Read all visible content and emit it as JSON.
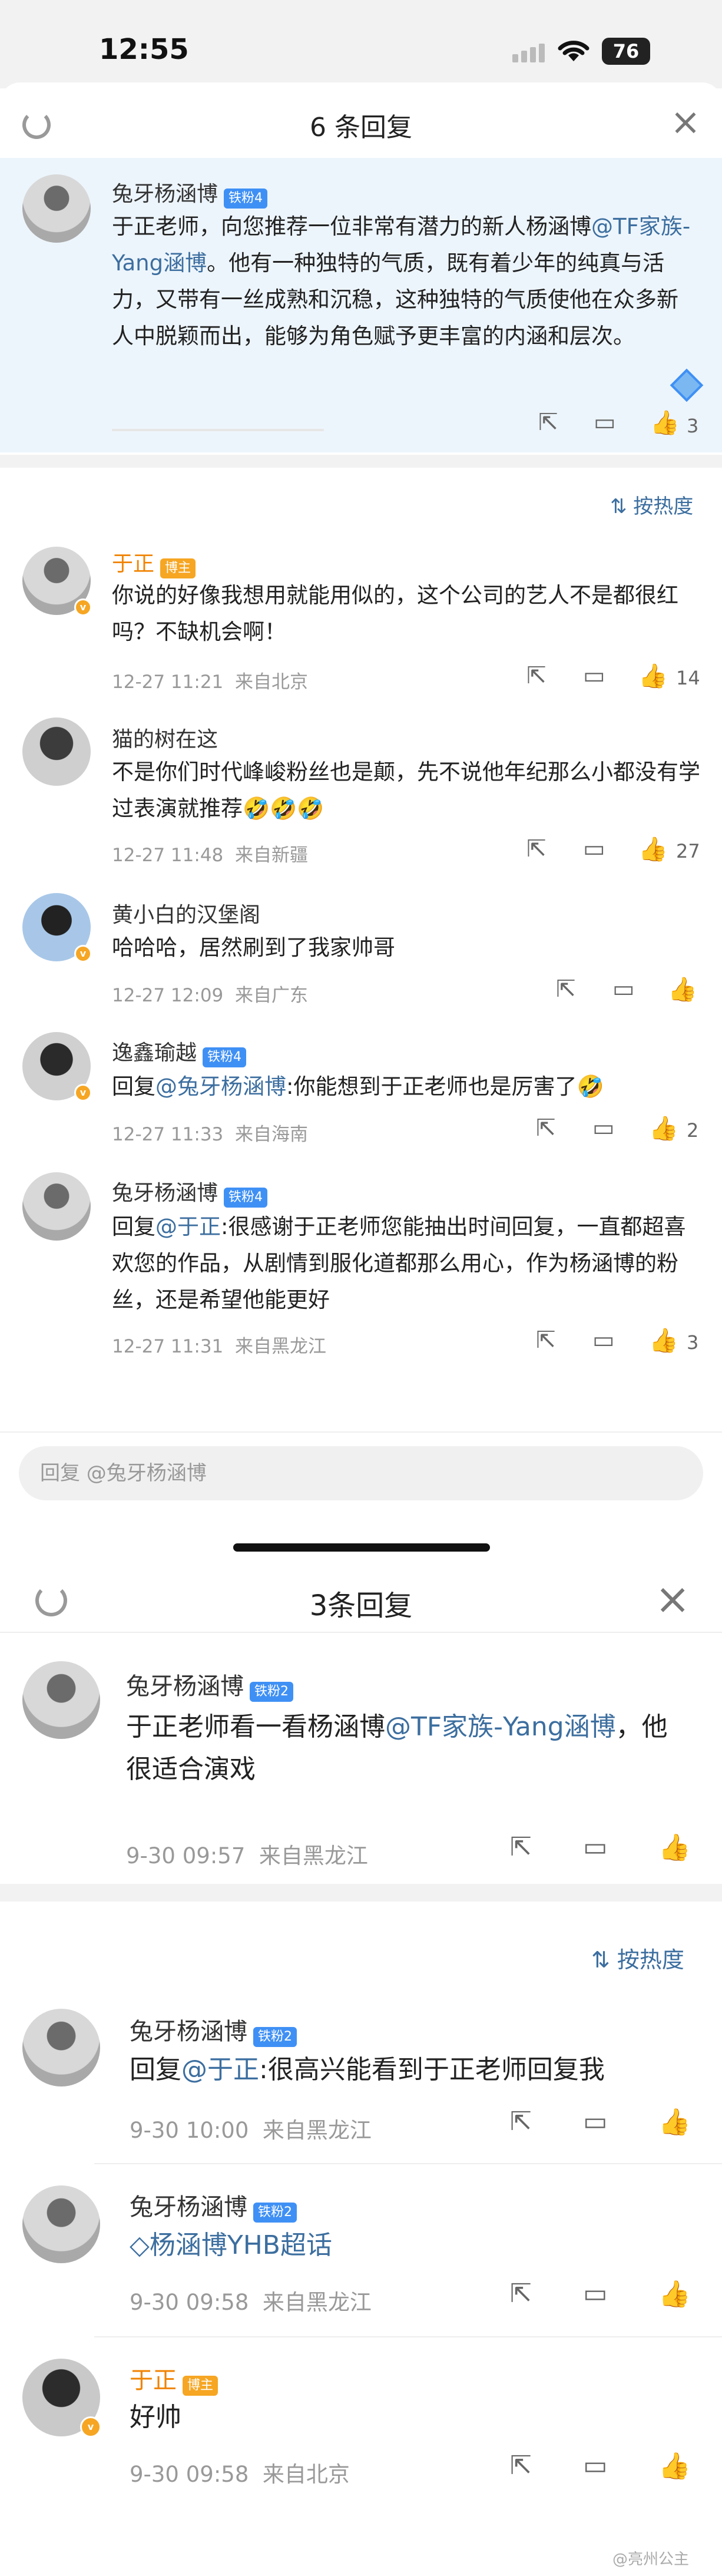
{
  "status_bar": {
    "time": "12:55",
    "battery": "76"
  },
  "sheet1": {
    "title": "6 条回复",
    "root": {
      "author": "兔牙杨涵博",
      "badge": "铁粉4",
      "text_a": "于正老师，向您推荐一位非常有潜力的新人杨涵博",
      "mention": "@TF家族-Yang涵博",
      "text_b": "。他有一种独特的气质，既有着少年的纯真与活力，又带有一丝成熟和沉稳，这种独特的气质使他在众多新人中脱颖而出，能够为角色赋予更丰富的内涵和层次。",
      "likes": "3"
    },
    "sort_label": "按热度",
    "replies": [
      {
        "author": "于正",
        "badge": "博主",
        "text": "你说的好像我想用就能用似的，这个公司的艺人不是都很红吗？不缺机会啊！",
        "time": "12-27 11:21",
        "location": "来自北京",
        "likes": "14"
      },
      {
        "author": "猫的树在这",
        "text": "不是你们时代峰峻粉丝也是颠，先不说他年纪那么小都没有学过表演就推荐",
        "time": "12-27 11:48",
        "location": "来自新疆",
        "likes": "27"
      },
      {
        "author": "黄小白的汉堡阁",
        "text": "哈哈哈，居然刷到了我家帅哥",
        "time": "12-27 12:09",
        "location": "来自广东",
        "likes": ""
      },
      {
        "author": "逸鑫瑜越",
        "badge": "铁粉4",
        "prefix": "回复",
        "mention": "@兔牙杨涵博",
        "text": ":你能想到于正老师也是厉害了",
        "time": "12-27 11:33",
        "location": "来自海南",
        "likes": "2"
      },
      {
        "author": "兔牙杨涵博",
        "badge": "铁粉4",
        "prefix": "回复",
        "mention": "@于正",
        "text": ":很感谢于正老师您能抽出时间回复，一直都超喜欢您的作品，从剧情到服化道都那么用心，作为杨涵博的粉丝，还是希望他能更好",
        "time": "12-27 11:31",
        "location": "来自黑龙江",
        "likes": "3"
      }
    ],
    "input_placeholder": "回复 @兔牙杨涵博"
  },
  "sheet2": {
    "title": "3条回复",
    "root": {
      "author": "兔牙杨涵博",
      "badge": "铁粉2",
      "text_a": "于正老师看一看杨涵博",
      "mention": "@TF家族-Yang涵博",
      "text_b": "，他很适合演戏",
      "time": "9-30 09:57",
      "location": "来自黑龙江"
    },
    "sort_label": "按热度",
    "replies": [
      {
        "author": "兔牙杨涵博",
        "badge": "铁粉2",
        "prefix": "回复",
        "mention": "@于正",
        "text": ":很高兴能看到于正老师回复我",
        "time": "9-30 10:00",
        "location": "来自黑龙江"
      },
      {
        "author": "兔牙杨涵博",
        "badge": "铁粉2",
        "supertopic": "杨涵博YHB超话",
        "time": "9-30 09:58",
        "location": "来自黑龙江"
      },
      {
        "author": "于正",
        "badge": "博主",
        "text": "好帅",
        "time": "9-30 09:58",
        "location": "来自北京"
      }
    ]
  },
  "watermark": "@亮州公主",
  "colors": {
    "link": "#3c6e9f",
    "host_name": "#f08300",
    "badge_blue": "#3f90f5",
    "badge_gold": "#f6a623",
    "highlight": "#edf5fc"
  }
}
